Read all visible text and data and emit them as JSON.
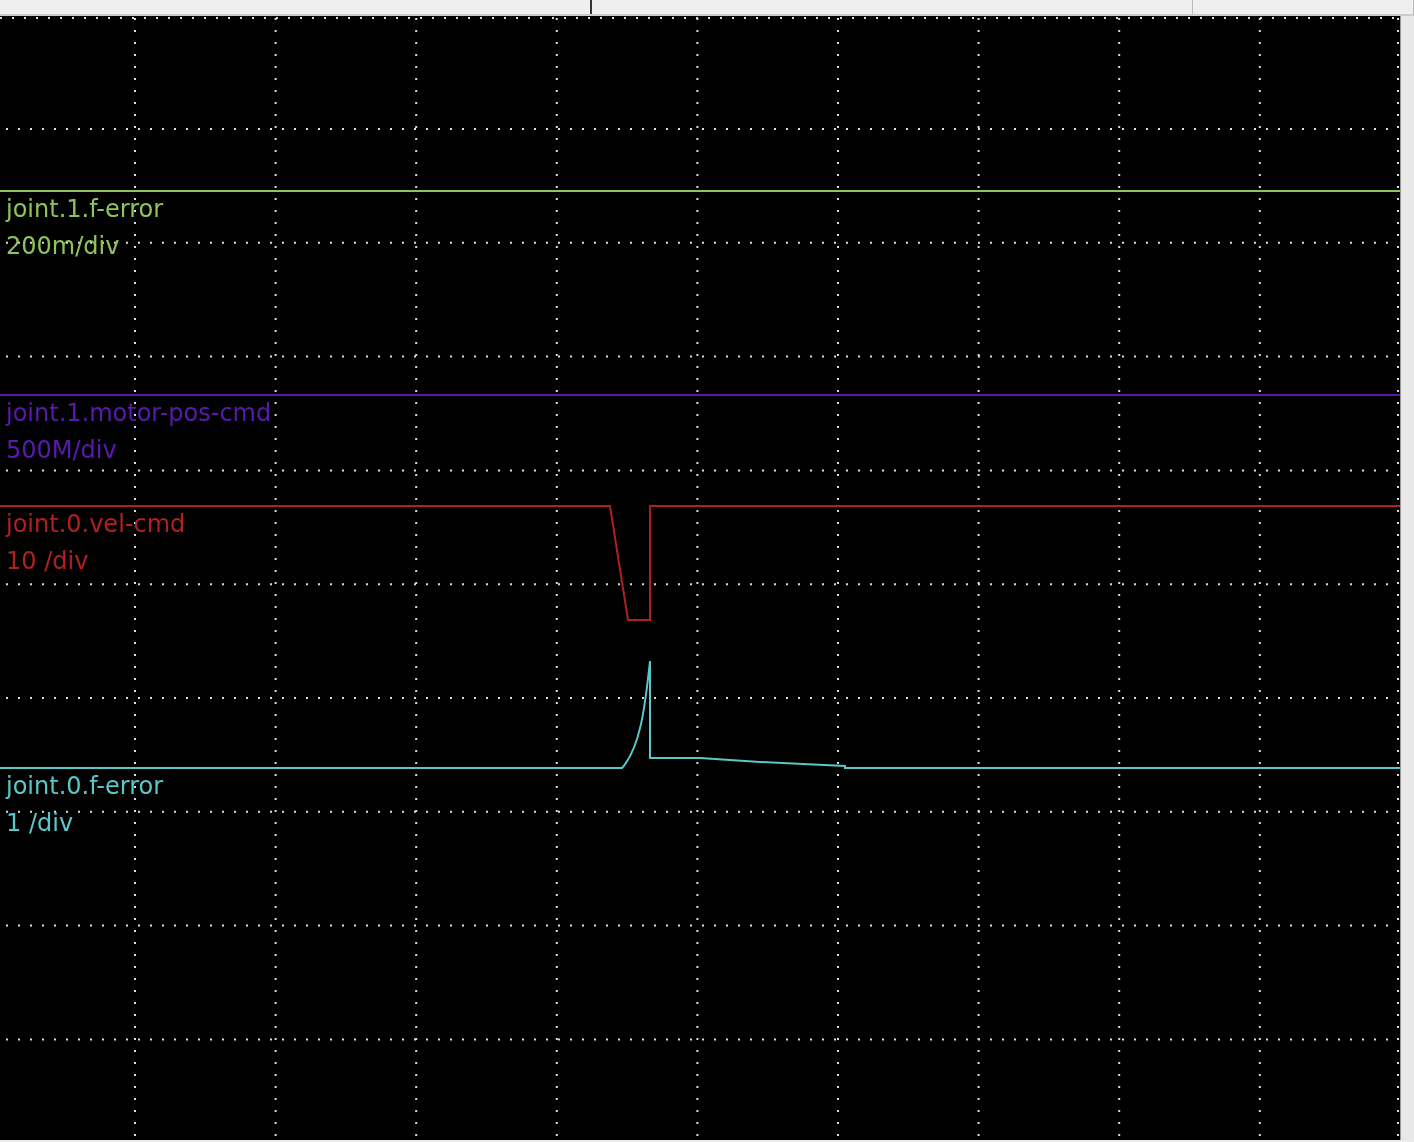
{
  "channels": [
    {
      "name": "joint.1.f-error",
      "scale": "200m/div",
      "color": "#8fc45a",
      "kind": "flat"
    },
    {
      "name": "joint.1.motor-pos-cmd",
      "scale": "500M/div",
      "color": "#5a1ab0",
      "kind": "flat"
    },
    {
      "name": "joint.0.vel-cmd",
      "scale": "10 /div",
      "color": "#b02020",
      "kind": "pulse"
    },
    {
      "name": "joint.0.f-error",
      "scale": "1 /div",
      "color": "#5ac8c8",
      "kind": "spike"
    }
  ]
}
